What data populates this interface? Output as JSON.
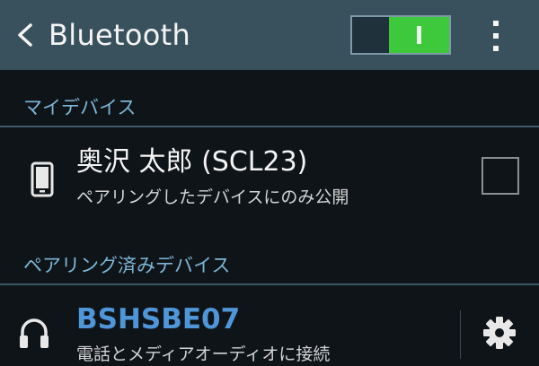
{
  "header": {
    "title": "Bluetooth",
    "toggle_state": "on",
    "back_icon": "chevron-left-icon",
    "menu_icon": "more-vertical-icon"
  },
  "my_devices": {
    "section_title": "マイデバイス",
    "device": {
      "name": "奥沢 太郎 (SCL23)",
      "subtitle": "ペアリングしたデバイスにのみ公開",
      "icon": "smartphone-icon",
      "checked": false
    }
  },
  "paired_devices": {
    "section_title": "ペアリング済みデバイス",
    "items": [
      {
        "name": "BSHSBE07",
        "subtitle": "電話とメディアオーディオに接続",
        "icon": "headphones-icon",
        "settings_icon": "gear-icon"
      }
    ]
  },
  "colors": {
    "header_bg": "#39505d",
    "background": "#0f1419",
    "section_text": "#7db6d6",
    "toggle_on": "#3ec83b",
    "device_link": "#4f96d8"
  }
}
